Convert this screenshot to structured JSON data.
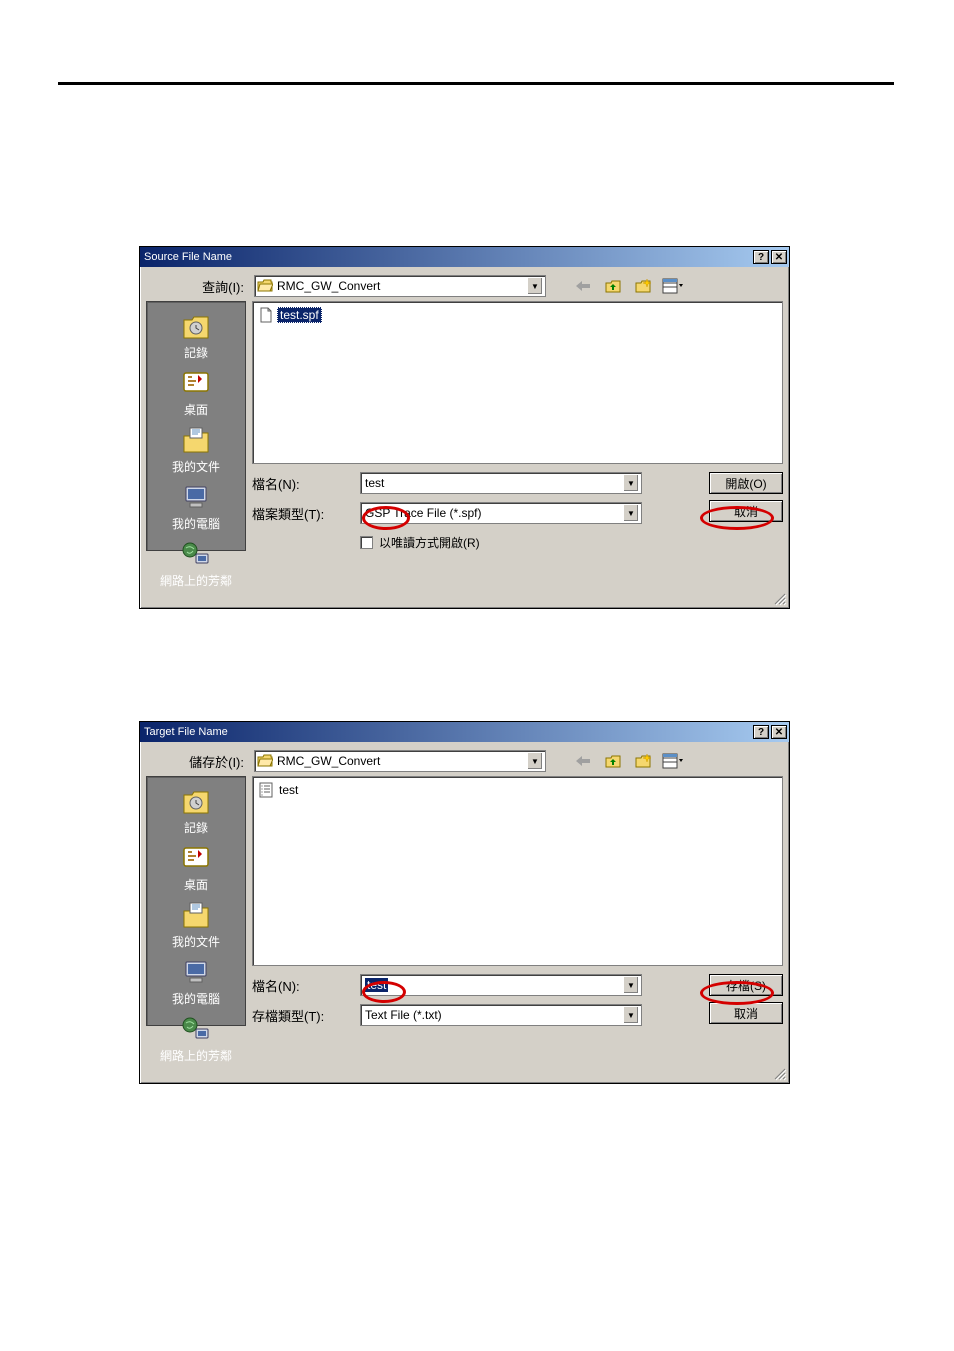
{
  "dialog1": {
    "title": "Source File Name",
    "lookin_label": "查詢(I):",
    "lookin_value": "RMC_GW_Convert",
    "file_item": {
      "label": "test.spf"
    },
    "sidebar": {
      "history": "記錄",
      "desktop": "桌面",
      "mydocs": "我的文件",
      "mycomputer": "我的電腦",
      "network": "網路上的芳鄰"
    },
    "filename_label": "檔名(N):",
    "filename_value": "test",
    "filetype_label": "檔案類型(T):",
    "filetype_value": "GSP Trace File (*.spf)",
    "readonly_label": "以唯讀方式開啟(R)",
    "open_button": "開啟(O)",
    "cancel_button": "取消"
  },
  "dialog2": {
    "title": "Target File Name",
    "savein_label": "儲存於(I):",
    "savein_value": "RMC_GW_Convert",
    "file_item": {
      "label": "test"
    },
    "sidebar": {
      "history": "記錄",
      "desktop": "桌面",
      "mydocs": "我的文件",
      "mycomputer": "我的電腦",
      "network": "網路上的芳鄰"
    },
    "filename_label": "檔名(N):",
    "filename_value": "test",
    "filetype_label": "存檔類型(T):",
    "filetype_value": "Text File (*.txt)",
    "save_button": "存檔(S)",
    "cancel_button": "取消"
  }
}
